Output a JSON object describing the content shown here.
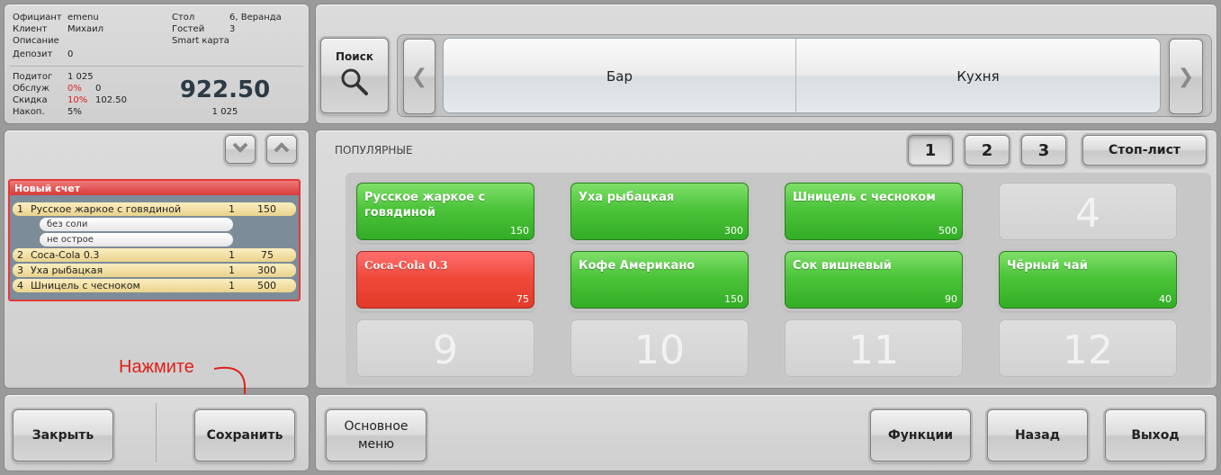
{
  "info": {
    "waiter_label": "Официант",
    "waiter_value": "emenu",
    "client_label": "Клиент",
    "client_value": "Михаил",
    "desc_label": "Описание",
    "deposit_label": "Депозит",
    "deposit_value": "0",
    "table_label": "Стол",
    "table_value": "6, Веранда",
    "guests_label": "Гостей",
    "guests_value": "3",
    "smart_card": "Smart карта",
    "subtotal_label": "Подитог",
    "subtotal_value": "1 025",
    "service_label": "Обслуж",
    "service_pct": "0%",
    "service_value": "0",
    "discount_label": "Скидка",
    "discount_pct": "10%",
    "discount_value": "102.50",
    "accum_label": "Накоп.",
    "accum_pct": "5%",
    "total": "922.50",
    "total_sub": "1 025"
  },
  "search": {
    "label": "Поиск"
  },
  "categories": [
    "Бар",
    "Кухня"
  ],
  "order": {
    "title": "Новый счет",
    "items": [
      {
        "num": "1",
        "name": "Русское жаркое с говядиной",
        "qty": "1",
        "price": "150"
      },
      {
        "num": "2",
        "name": "Coca-Cola 0.3",
        "qty": "1",
        "price": "75"
      },
      {
        "num": "3",
        "name": "Уха рыбацкая",
        "qty": "1",
        "price": "300"
      },
      {
        "num": "4",
        "name": "Шницель с чесноком",
        "qty": "1",
        "price": "500"
      }
    ],
    "modifiers": [
      "без соли",
      "не острое"
    ]
  },
  "menu": {
    "section_title": "ПОПУЛЯРНЫЕ",
    "pages": [
      "1",
      "2",
      "3"
    ],
    "active_page": "1",
    "stoplist_label": "Стоп-лист",
    "tiles": [
      {
        "name": "Русское жаркое с говядиной",
        "price": "150",
        "color": "green"
      },
      {
        "name": "Уха рыбацкая",
        "price": "300",
        "color": "green"
      },
      {
        "name": "Шницель с чесноком",
        "price": "500",
        "color": "green"
      },
      {
        "num": "4"
      },
      {
        "name": "Coca-Cola 0.3",
        "price": "75",
        "color": "red"
      },
      {
        "name": "Кофе Американо",
        "price": "150",
        "color": "green"
      },
      {
        "name": "Сок вишневый",
        "price": "90",
        "color": "green"
      },
      {
        "name": "Чёрный чай",
        "price": "40",
        "color": "green"
      },
      {
        "num": "9"
      },
      {
        "num": "10"
      },
      {
        "num": "11"
      },
      {
        "num": "12"
      }
    ]
  },
  "bottom": {
    "close_label": "Закрыть",
    "save_label": "Сохранить",
    "main_menu_label": "Основное меню",
    "functions_label": "Функции",
    "back_label": "Назад",
    "exit_label": "Выход"
  },
  "annotation": {
    "text": "Нажмите",
    "color": "#e0201a"
  },
  "colors": {
    "tile_green": "#4cc43a",
    "tile_red": "#f04a3c",
    "order_border": "#e03a3a"
  }
}
